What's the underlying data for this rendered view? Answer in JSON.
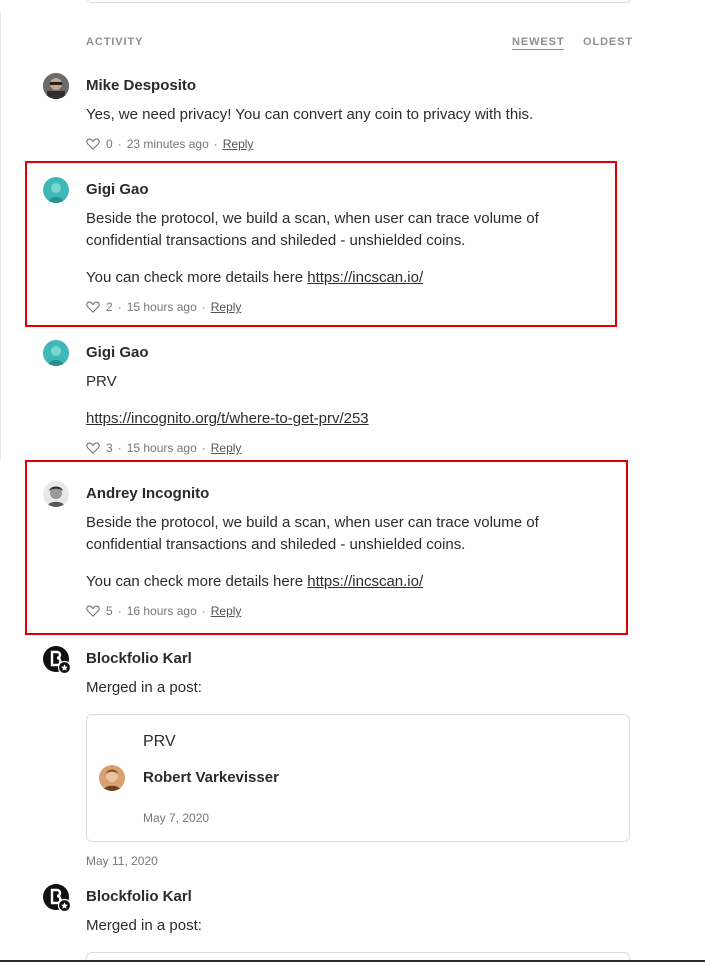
{
  "header": {
    "activity_label": "ACTIVITY",
    "sort_newest": "NEWEST",
    "sort_oldest": "OLDEST"
  },
  "comments": [
    {
      "author": "Mike Desposito",
      "text": "Yes, we need privacy! You can convert any coin to privacy with this.",
      "likes": "0",
      "time": "23 minutes ago",
      "reply": "Reply"
    },
    {
      "author": "Gigi Gao",
      "line1": "Beside the protocol, we build a scan, when user can trace volume of confidential transactions and shileded - unshielded coins.",
      "line2_prefix": "You can check more details here ",
      "link": "https://incscan.io/",
      "likes": "2",
      "time": "15 hours ago",
      "reply": "Reply"
    },
    {
      "author": "Gigi Gao",
      "line1": "PRV",
      "link": "https://incognito.org/t/where-to-get-prv/253",
      "likes": "3",
      "time": "15 hours ago",
      "reply": "Reply"
    },
    {
      "author": "Andrey Incognito",
      "line1": "Beside the protocol, we build a scan, when user can trace volume of confidential transactions and shileded - unshielded coins.",
      "line2_prefix": "You can check more details here ",
      "link": "https://incscan.io/",
      "likes": "5",
      "time": "16 hours ago",
      "reply": "Reply"
    },
    {
      "author": "Blockfolio Karl",
      "text": "Merged in a post:",
      "card": {
        "title": "PRV",
        "author": "Robert Varkevisser",
        "date": "May 7, 2020"
      },
      "date": "May 11, 2020"
    },
    {
      "author": "Blockfolio Karl",
      "text": "Merged in a post:"
    }
  ],
  "separators": {
    "dot": "·"
  },
  "colors": {
    "highlight": "#e00000",
    "text": "#2b2b2b",
    "muted": "#777777"
  },
  "icons": {
    "like": "heart-outline-icon",
    "blockfolio": "blockfolio-logo-icon"
  }
}
